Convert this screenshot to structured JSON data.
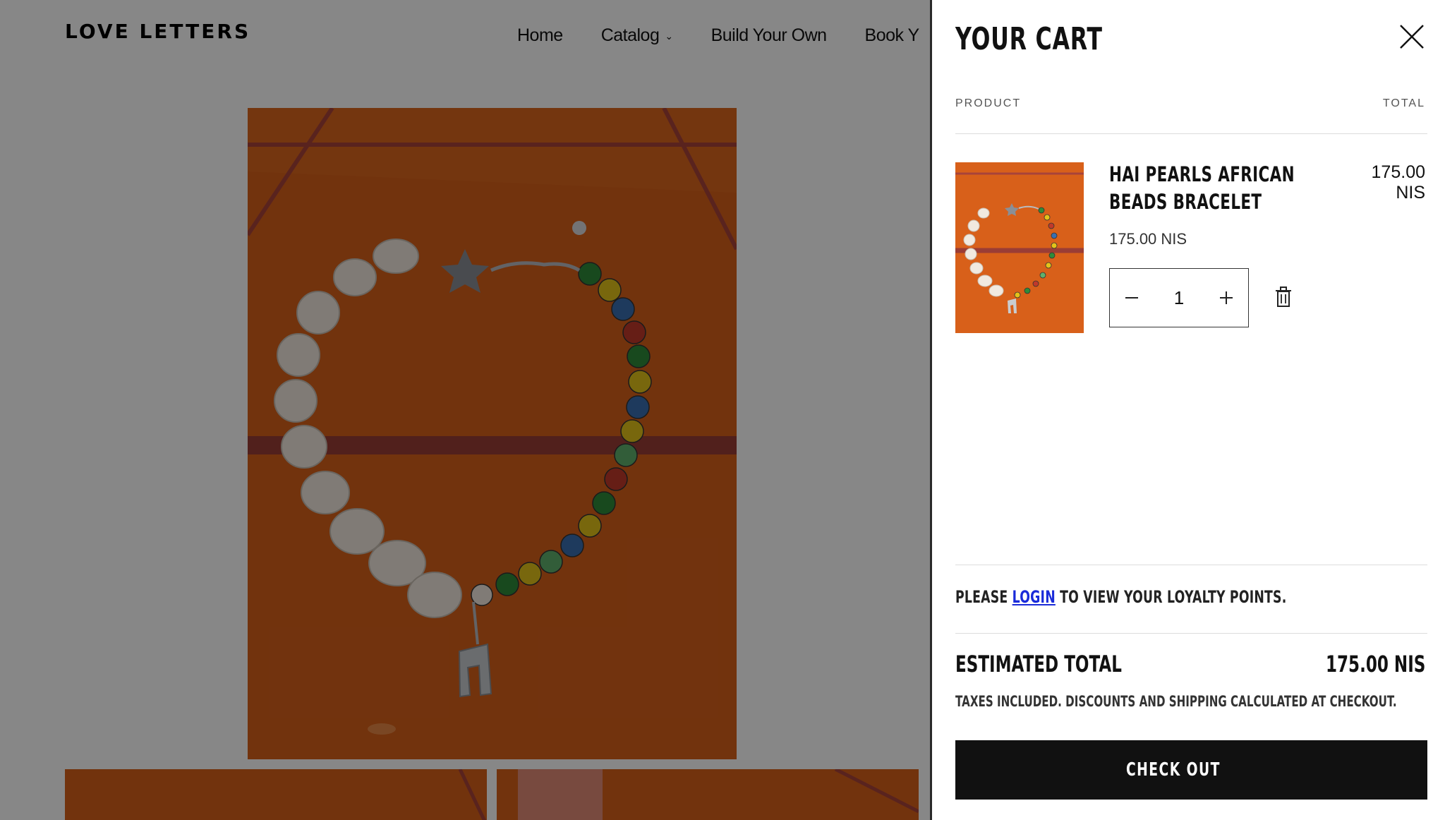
{
  "header": {
    "logo": "LOVE LETTERS",
    "nav": [
      "Home",
      "Catalog",
      "Build Your Own",
      "Book Y"
    ]
  },
  "cart": {
    "title": "YOUR CART",
    "col_product": "PRODUCT",
    "col_total": "TOTAL",
    "item": {
      "name_line1": "HAI PEARLS AFRICAN",
      "name_line2": "BEADS BRACELET",
      "unit_price": "175.00 NIS",
      "line_total_amount": "175.00",
      "line_total_currency": "NIS",
      "quantity": "1"
    },
    "loyalty_prefix": "PLEASE",
    "loyalty_link": "LOGIN",
    "loyalty_suffix": "TO VIEW YOUR LOYALTY POINTS.",
    "estimated_total_label": "ESTIMATED TOTAL",
    "estimated_total_value": "175.00 NIS",
    "taxes_note": "TAXES INCLUDED. DISCOUNTS AND SHIPPING CALCULATED AT CHECKOUT.",
    "checkout_label": "CHECK OUT"
  },
  "colors": {
    "photo_orange": "#d8601a",
    "overlay": "#000000",
    "link_blue": "#1a2bd9",
    "button_black": "#111111"
  },
  "icons": [
    "close-icon",
    "minus-icon",
    "plus-icon",
    "trash-icon",
    "chevron-down-icon"
  ]
}
